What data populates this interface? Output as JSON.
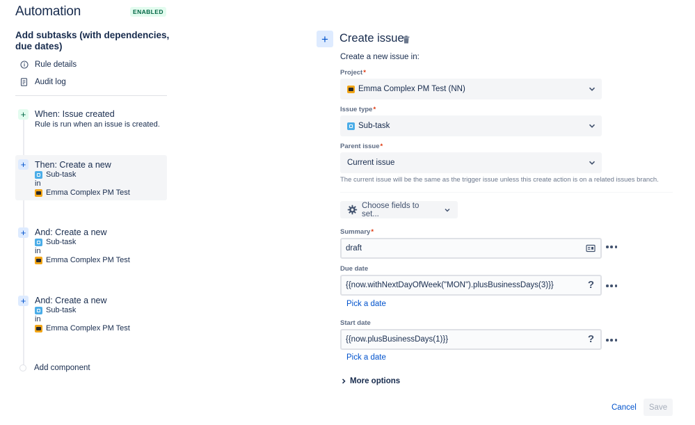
{
  "header": {
    "title": "Automation",
    "status_badge": "ENABLED"
  },
  "rule": {
    "name": "Add subtasks (with dependencies, due dates)"
  },
  "sidebar": {
    "links": [
      {
        "label": "Rule details",
        "icon": "info-icon"
      },
      {
        "label": "Audit log",
        "icon": "document-icon"
      }
    ]
  },
  "steps": [
    {
      "title": "When: Issue created",
      "description": "Rule is run when an issue is created."
    },
    {
      "title": "Then: Create a new",
      "issue_type": "Sub-task",
      "connector": "in",
      "project": "Emma Complex PM Test"
    },
    {
      "title": "And: Create a new",
      "issue_type": "Sub-task",
      "connector": "in",
      "project": "Emma Complex PM Test"
    },
    {
      "title": "And: Create a new",
      "issue_type": "Sub-task",
      "connector": "in",
      "project": "Emma Complex PM Test"
    }
  ],
  "add_component_label": "Add component",
  "panel": {
    "title": "Create issue",
    "intro": "Create a new issue in:",
    "project": {
      "label": "Project",
      "value": "Emma Complex PM Test (NN)"
    },
    "issue_type": {
      "label": "Issue type",
      "value": "Sub-task"
    },
    "parent_issue": {
      "label": "Parent issue",
      "value": "Current issue",
      "helper": "The current issue will be the same as the trigger issue unless this create action is on a related issues branch."
    },
    "choose_fields_label": "Choose fields to set...",
    "summary": {
      "label": "Summary",
      "value": "draft"
    },
    "due_date": {
      "label": "Due date",
      "value": "{{now.withNextDayOfWeek(\"MON\").plusBusinessDays(3)}}",
      "help": "?",
      "pick_label": "Pick a date"
    },
    "start_date": {
      "label": "Start date",
      "value": "{{now.plusBusinessDays(1)}}",
      "help": "?",
      "pick_label": "Pick a date"
    },
    "more_options_label": "More options",
    "required_mark": "*"
  },
  "footer": {
    "cancel_label": "Cancel",
    "save_label": "Save"
  },
  "colors": {
    "primary_blue": "#0052cc",
    "success_green": "#006644",
    "required_red": "#de350b",
    "subtask_blue": "#4bade8",
    "project_orange": "#f2a516"
  }
}
